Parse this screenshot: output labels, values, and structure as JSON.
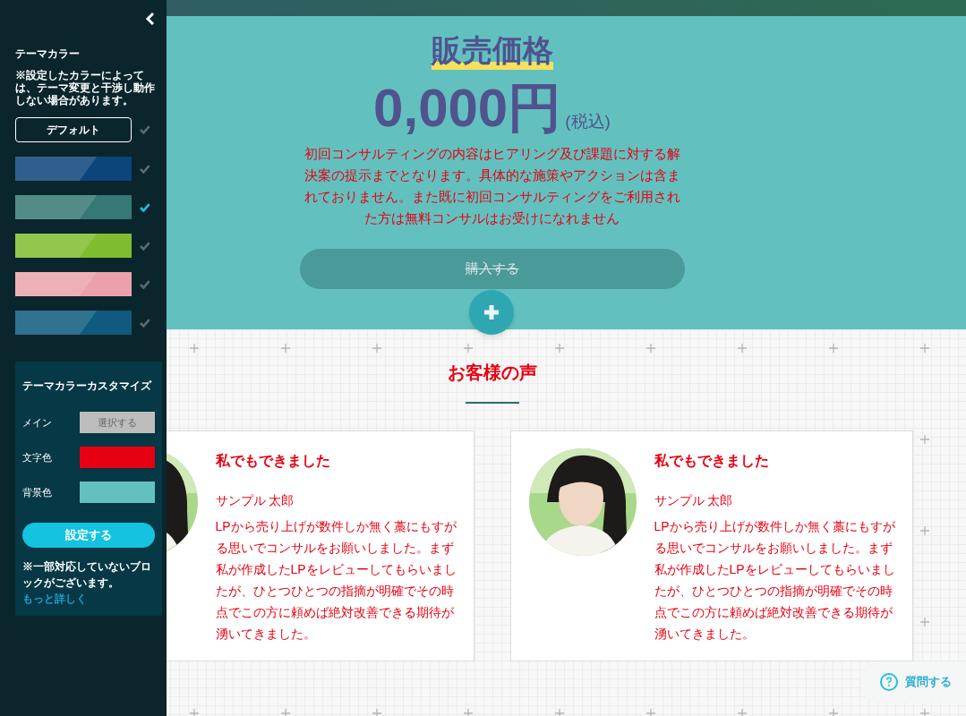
{
  "sidebar": {
    "title": "テーマカラー",
    "note": "※設定したカラーによっては、テーマ変更と干渉し動作しない場合があります。",
    "themes": [
      {
        "kind": "button",
        "label": "デフォルト",
        "selected": false
      },
      {
        "kind": "swatch",
        "color": "#0b457a",
        "selected": false
      },
      {
        "kind": "swatch",
        "color": "#367873",
        "selected": true
      },
      {
        "kind": "swatch",
        "color": "#80bd2e",
        "selected": false
      },
      {
        "kind": "swatch",
        "color": "#eba1ab",
        "selected": false
      },
      {
        "kind": "swatch",
        "color": "#0f5a7e",
        "selected": false
      }
    ],
    "customize": {
      "title": "テーマカラーカスタマイズ",
      "fields": [
        {
          "kind": "button",
          "label": "メイン",
          "value": "選択する"
        },
        {
          "kind": "color",
          "label": "文字色",
          "color": "#e60012"
        },
        {
          "kind": "color",
          "label": "背景色",
          "color": "#62c1bf"
        }
      ],
      "apply_button": "設定する",
      "note": "※一部対応していないブロックがございます。",
      "link": "もっと詳しく"
    }
  },
  "pricing": {
    "title": "販売価格",
    "price": "0,000円",
    "tax": "(税込)",
    "description": "初回コンサルティングの内容はヒアリング及び課題に対する解決案の提示までとなります。具体的な施策やアクションは含まれておりません。また既に初回コンサルティングをご利用された方は無料コンサルはお受けになれません",
    "buy_button": "購入する"
  },
  "testimonials": {
    "title": "お客様の声",
    "cards": [
      {
        "heading": "私でもできました",
        "name": "サンプル 太郎",
        "body": "LPから売り上げが数件しか無く藁にもすがる思いでコンサルをお願いしました。まず私が作成したLPをレビューしてもらいましたが、ひとつひとつの指摘が明確でその時点でこの方に頼めば絶対改善できる期待が湧いてきました。"
      },
      {
        "heading": "私でもできました",
        "name": "サンプル 太郎",
        "body": "LPから売り上げが数件しか無く藁にもすがる思いでコンサルをお願いしました。まず私が作成したLPをレビューしてもらいましたが、ひとつひとつの指摘が明確でその時点でこの方に頼めば絶対改善できる期待が湧いてきました。"
      }
    ]
  },
  "help_button": "質問する"
}
